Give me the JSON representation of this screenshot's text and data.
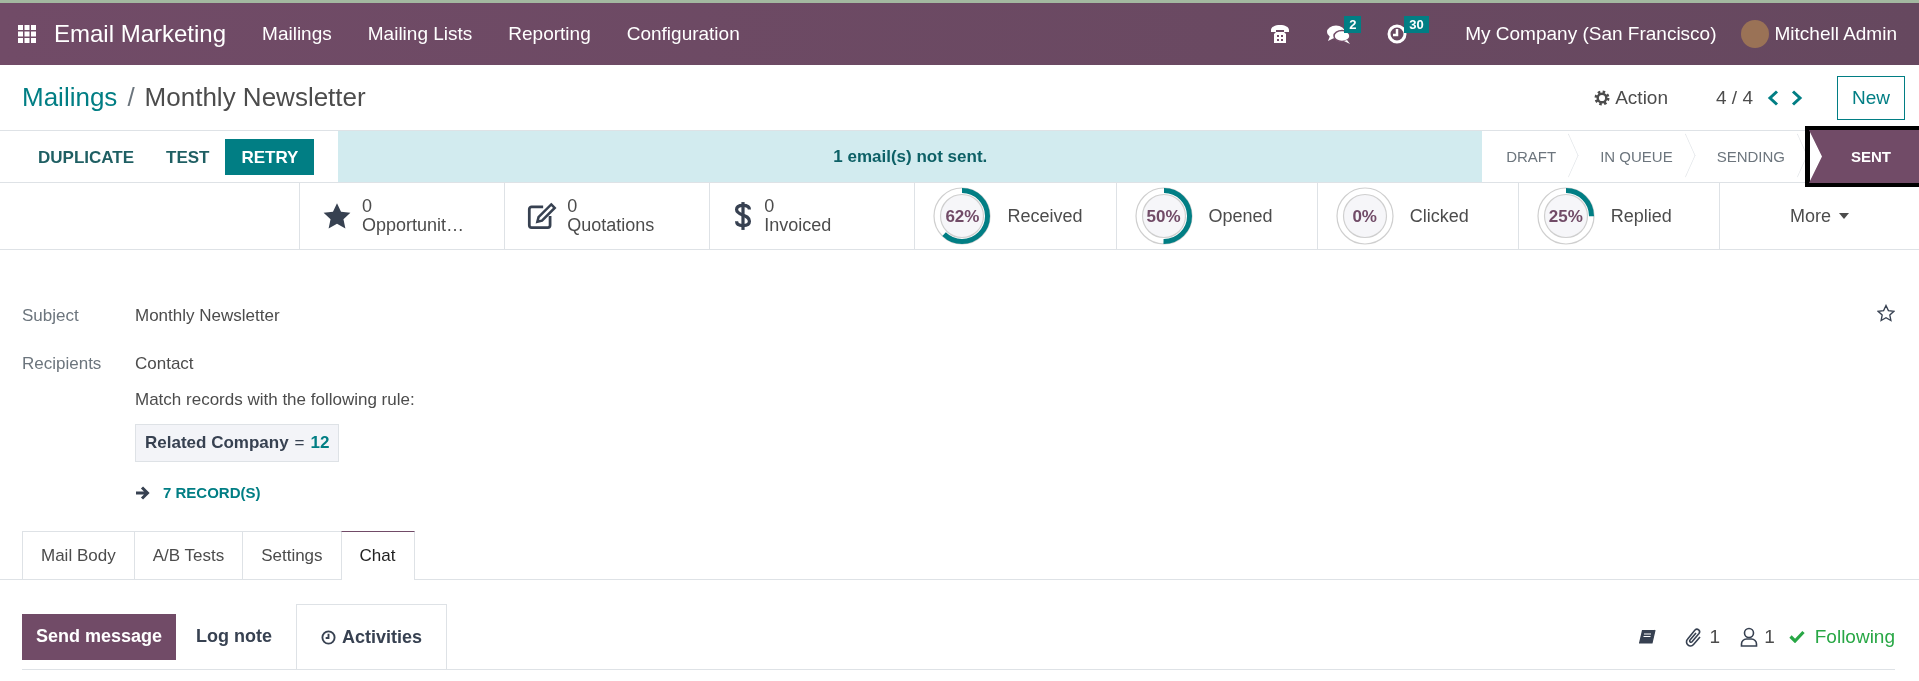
{
  "navbar": {
    "app": "Email Marketing",
    "menus": [
      "Mailings",
      "Mailing Lists",
      "Reporting",
      "Configuration"
    ],
    "messages_badge": "2",
    "activities_badge": "30",
    "company": "My Company (San Francisco)",
    "user": "Mitchell Admin"
  },
  "breadcrumb": {
    "parent": "Mailings",
    "separator": "/",
    "current": "Monthly Newsletter"
  },
  "controls": {
    "action": "Action",
    "pager": "4 / 4",
    "new_button": "New"
  },
  "header_buttons": [
    {
      "label": "DUPLICATE",
      "primary": false
    },
    {
      "label": "TEST",
      "primary": false
    },
    {
      "label": "RETRY",
      "primary": true
    }
  ],
  "alert": "1 email(s) not sent.",
  "stages": [
    {
      "label": "DRAFT",
      "selected": false,
      "highlighted": false
    },
    {
      "label": "IN QUEUE",
      "selected": false,
      "highlighted": false
    },
    {
      "label": "SENDING",
      "selected": false,
      "highlighted": false
    },
    {
      "label": "SENT",
      "selected": true,
      "highlighted": true
    }
  ],
  "stat_buttons": [
    {
      "kind": "count",
      "value": "0",
      "label": "Opportunit…"
    },
    {
      "kind": "count",
      "value": "0",
      "label": "Quotations"
    },
    {
      "kind": "count",
      "value": "0",
      "label": "Invoiced"
    },
    {
      "kind": "rate",
      "percent": "62%",
      "level": 0.62,
      "label": "Received"
    },
    {
      "kind": "rate",
      "percent": "50%",
      "level": 0.5,
      "label": "Opened"
    },
    {
      "kind": "rate",
      "percent": "0%",
      "level": 0,
      "label": "Clicked"
    },
    {
      "kind": "rate",
      "percent": "25%",
      "level": 0.25,
      "label": "Replied"
    },
    {
      "kind": "more",
      "label": "More"
    }
  ],
  "form": {
    "subject_label": "Subject",
    "subject": "Monthly Newsletter",
    "recipients_label": "Recipients",
    "recipients": "Contact",
    "rule_intro": "Match records with the following rule:",
    "rule": {
      "field": "Related Company",
      "operator": "=",
      "value": "12"
    },
    "records_link": "7 RECORD(S)"
  },
  "tabs": [
    {
      "label": "Mail Body",
      "selected": false
    },
    {
      "label": "A/B Tests",
      "selected": false
    },
    {
      "label": "Settings",
      "selected": false
    },
    {
      "label": "Chat",
      "selected": true
    }
  ],
  "chatter": {
    "buttons": [
      {
        "kind": "primary",
        "label": "Send message"
      },
      {
        "kind": "plain",
        "label": "Log note"
      },
      {
        "kind": "activities",
        "label": "Activities"
      }
    ],
    "attachments": "1",
    "followers": "1",
    "follow": "Following"
  }
}
